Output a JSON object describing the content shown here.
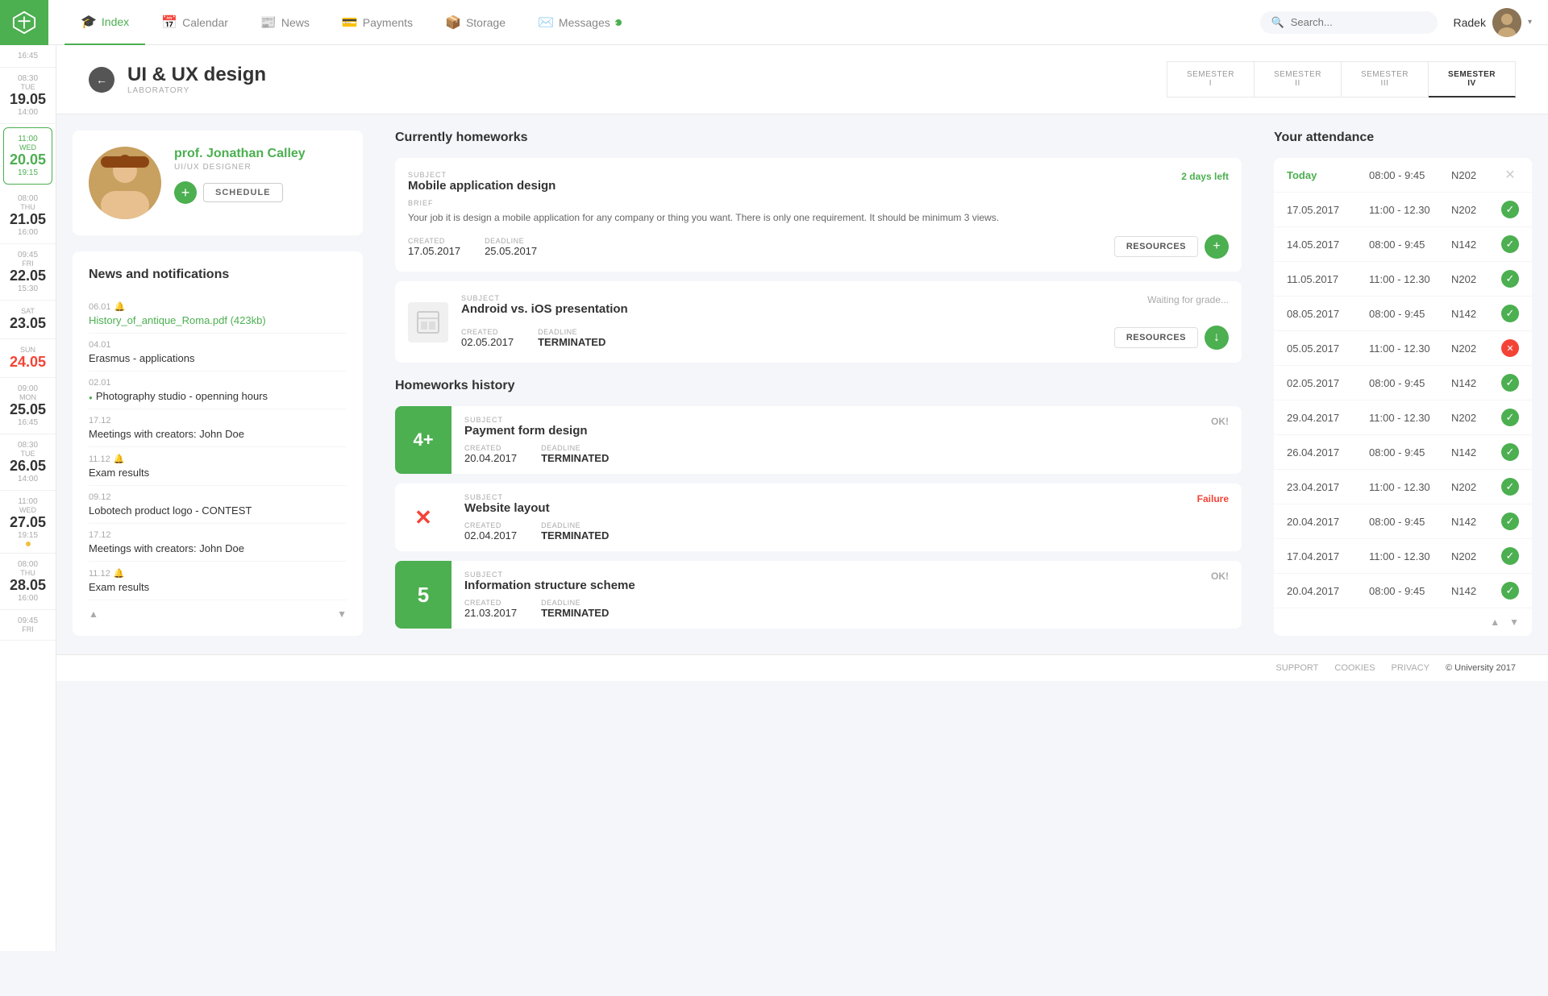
{
  "nav": {
    "logo_alt": "University Logo",
    "items": [
      {
        "id": "index",
        "label": "Index",
        "icon": "🎓",
        "active": true
      },
      {
        "id": "calendar",
        "label": "Calendar",
        "icon": "📅",
        "active": false
      },
      {
        "id": "news",
        "label": "News",
        "icon": "📰",
        "active": false
      },
      {
        "id": "payments",
        "label": "Payments",
        "icon": "💳",
        "active": false
      },
      {
        "id": "storage",
        "label": "Storage",
        "icon": "📦",
        "active": false
      },
      {
        "id": "messages",
        "label": "Messages",
        "icon": "✉️",
        "active": false,
        "badge": true
      }
    ],
    "search_placeholder": "Search...",
    "user_name": "Radek"
  },
  "calendar_days": [
    {
      "time": "16:45",
      "dow": "",
      "date": "",
      "dim": true
    },
    {
      "time": "08:30",
      "dow": "TUE",
      "date": "19.05",
      "extra": "14:00"
    },
    {
      "time": "11:00",
      "dow": "WED",
      "date": "20.05",
      "extra": "19:15",
      "today": true
    },
    {
      "time": "08:00",
      "dow": "THU",
      "date": "21.05",
      "extra": "16:00"
    },
    {
      "time": "09:45",
      "dow": "FRI",
      "date": "22.05",
      "extra": "15:30"
    },
    {
      "time": "",
      "dow": "SAT",
      "date": "23.05",
      "extra": ""
    },
    {
      "time": "",
      "dow": "SUN",
      "date": "24.05",
      "extra": "",
      "sun": true
    },
    {
      "time": "09:00",
      "dow": "MON",
      "date": "25.05",
      "extra": "16:45"
    },
    {
      "time": "08:30",
      "dow": "TUE",
      "date": "26.05",
      "extra": "14:00"
    },
    {
      "time": "11:00",
      "dow": "WED",
      "date": "27.05",
      "extra": "19:15",
      "dot": true
    },
    {
      "time": "08:00",
      "dow": "THU",
      "date": "28.05",
      "extra": "16:00"
    },
    {
      "time": "09:45",
      "dow": "FRI",
      "date": "",
      "extra": ""
    }
  ],
  "page": {
    "back_label": "←",
    "title": "UI & UX design",
    "subtitle": "LABORATORY",
    "semesters": [
      {
        "label": "SEMESTER\nI",
        "active": false
      },
      {
        "label": "SEMESTER\nII",
        "active": false
      },
      {
        "label": "SEMESTER\nIII",
        "active": false
      },
      {
        "label": "SEMESTER\nIV",
        "active": true
      }
    ]
  },
  "professor": {
    "name": "prof. Jonathan Calley",
    "role": "UI/UX DESIGNER",
    "add_btn": "+",
    "schedule_btn": "SCHEDULE"
  },
  "news": {
    "title": "News and notifications",
    "items": [
      {
        "date": "06.01",
        "bell": true,
        "text": "History_of_antique_Roma.pdf (423kb)",
        "highlight": true
      },
      {
        "date": "04.01",
        "text": "Erasmus - applications"
      },
      {
        "date": "02.01",
        "text": "Photography studio - openning hours",
        "dot": true
      },
      {
        "date": "17.12",
        "text": "Meetings with creators: John Doe"
      },
      {
        "date": "11.12",
        "bell": true,
        "text": "Exam results"
      },
      {
        "date": "09.12",
        "text": "Lobotech product logo - CONTEST"
      },
      {
        "date": "17.12",
        "text": "Meetings with creators: John Doe"
      },
      {
        "date": "11.12",
        "bell": true,
        "text": "Exam results"
      }
    ],
    "up_label": "▲",
    "down_label": "▼"
  },
  "homeworks": {
    "current_title": "Currently homeworks",
    "items": [
      {
        "subject_label": "SUBJECT",
        "subject": "Mobile application design",
        "status": "2 days left",
        "status_type": "green",
        "brief_label": "BRIEF",
        "brief": "Your job it is design a mobile application for any company or thing you want. There is only one requirement. It should be minimum 3 views.",
        "created_label": "CREATED",
        "created": "17.05.2017",
        "deadline_label": "DEADLINE",
        "deadline": "25.05.2017",
        "resources_btn": "RESOURCES",
        "action": "plus"
      },
      {
        "subject_label": "SUBJECT",
        "subject": "Android vs. iOS presentation",
        "status": "Waiting for grade...",
        "status_type": "waiting",
        "created_label": "CREATED",
        "created": "02.05.2017",
        "deadline_label": "DEADLINE",
        "deadline": "TERMINATED",
        "resources_btn": "RESOURCES",
        "action": "down",
        "has_thumb": true
      }
    ],
    "history_title": "Homeworks history",
    "history_items": [
      {
        "grade": "4+",
        "grade_bg": "green",
        "subject_label": "SUBJECT",
        "subject": "Payment form design",
        "status": "OK!",
        "status_type": "ok",
        "created_label": "CREATED",
        "created": "20.04.2017",
        "deadline_label": "DEADLINE",
        "deadline": "TERMINATED"
      },
      {
        "grade": "✕",
        "grade_bg": "fail",
        "subject_label": "SUBJECT",
        "subject": "Website layout",
        "status": "Failure",
        "status_type": "fail",
        "created_label": "CREATED",
        "created": "02.04.2017",
        "deadline_label": "DEADLINE",
        "deadline": "TERMINATED"
      },
      {
        "grade": "5",
        "grade_bg": "green",
        "subject_label": "SUBJECT",
        "subject": "Information structure scheme",
        "status": "OK!",
        "status_type": "ok",
        "created_label": "CREATED",
        "created": "21.03.2017",
        "deadline_label": "DEADLINE",
        "deadline": "TERMINATED"
      }
    ]
  },
  "attendance": {
    "title": "Your attendance",
    "rows": [
      {
        "date": "Today",
        "date_today": true,
        "time": "08:00 - 9:45",
        "room": "N202",
        "status": "none"
      },
      {
        "date": "17.05.2017",
        "time": "11:00 - 12.30",
        "room": "N202",
        "status": "ok"
      },
      {
        "date": "14.05.2017",
        "time": "08:00 - 9:45",
        "room": "N142",
        "status": "ok"
      },
      {
        "date": "11.05.2017",
        "time": "11:00 - 12.30",
        "room": "N202",
        "status": "ok"
      },
      {
        "date": "08.05.2017",
        "time": "08:00 - 9:45",
        "room": "N142",
        "status": "ok"
      },
      {
        "date": "05.05.2017",
        "time": "11:00 - 12.30",
        "room": "N202",
        "status": "fail"
      },
      {
        "date": "02.05.2017",
        "time": "08:00 - 9:45",
        "room": "N142",
        "status": "ok"
      },
      {
        "date": "29.04.2017",
        "time": "11:00 - 12.30",
        "room": "N202",
        "status": "ok"
      },
      {
        "date": "26.04.2017",
        "time": "08:00 - 9:45",
        "room": "N142",
        "status": "ok"
      },
      {
        "date": "23.04.2017",
        "time": "11:00 - 12.30",
        "room": "N202",
        "status": "ok"
      },
      {
        "date": "20.04.2017",
        "time": "08:00 - 9:45",
        "room": "N142",
        "status": "ok"
      },
      {
        "date": "17.04.2017",
        "time": "11:00 - 12.30",
        "room": "N202",
        "status": "ok"
      },
      {
        "date": "20.04.2017",
        "time": "08:00 - 9:45",
        "room": "N142",
        "status": "ok"
      }
    ],
    "up_label": "▲",
    "down_label": "▼"
  },
  "footer": {
    "support": "SUPPORT",
    "cookies": "COOKIES",
    "privacy": "PRIVACY",
    "copyright": "© University 2017"
  }
}
